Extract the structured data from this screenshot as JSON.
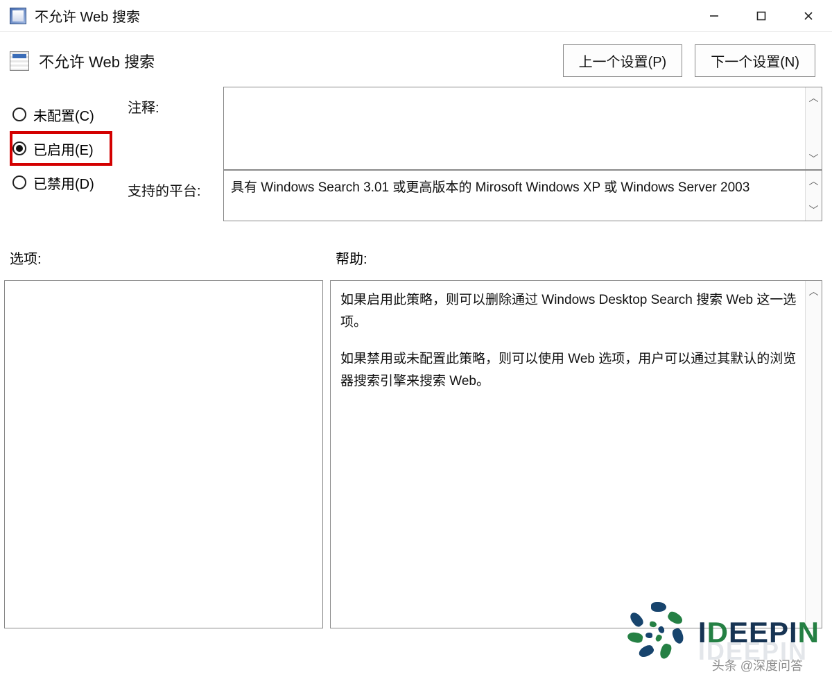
{
  "window": {
    "title": "不允许 Web 搜索"
  },
  "header": {
    "title": "不允许 Web 搜索",
    "prev_button": "上一个设置(P)",
    "next_button": "下一个设置(N)"
  },
  "radios": {
    "not_configured": "未配置(C)",
    "enabled": "已启用(E)",
    "disabled": "已禁用(D)",
    "selected": "enabled"
  },
  "labels": {
    "comment": "注释:",
    "supported": "支持的平台:",
    "options": "选项:",
    "help": "帮助:"
  },
  "fields": {
    "comment": "",
    "supported": "具有 Windows Search 3.01 或更高版本的 Mirosoft Windows XP 或 Windows Server 2003"
  },
  "help": {
    "p1": "如果启用此策略，则可以删除通过 Windows Desktop Search 搜索 Web 这一选项。",
    "p2": "如果禁用或未配置此策略，则可以使用 Web 选项，用户可以通过其默认的浏览器搜索引擎来搜索 Web。"
  },
  "watermark": {
    "brand": "IDEEPIN",
    "credit": "头条 @深度问答"
  }
}
